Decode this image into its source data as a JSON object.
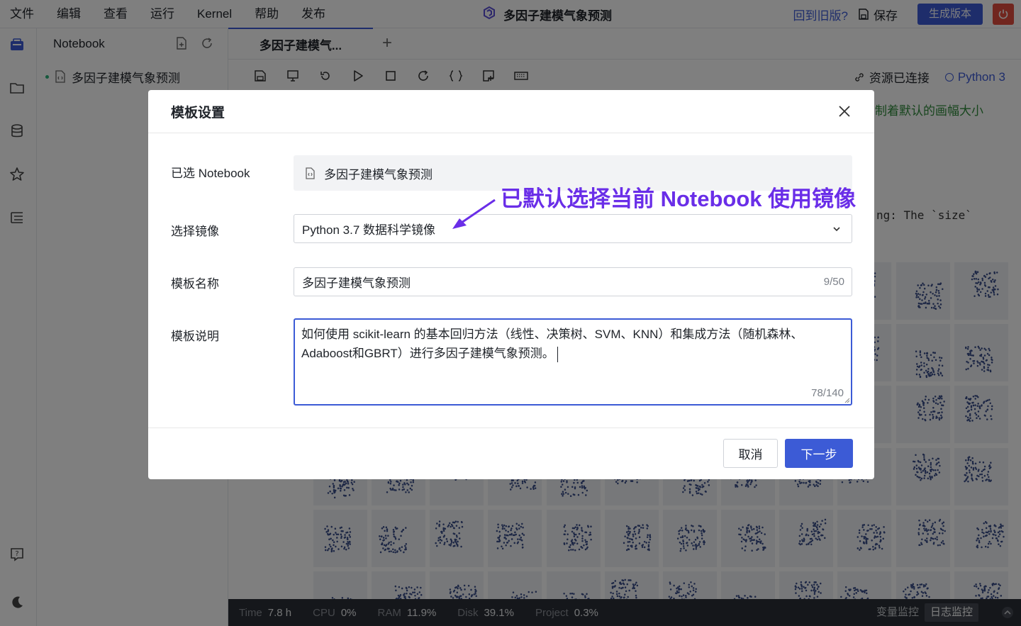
{
  "menubar": {
    "items": [
      "文件",
      "编辑",
      "查看",
      "运行",
      "Kernel",
      "帮助",
      "发布"
    ],
    "title": "多因子建模气象预测",
    "old_version": "回到旧版?",
    "save": "保存",
    "generate": "生成版本"
  },
  "filepanel": {
    "header": "Notebook",
    "file": "多因子建模气象预测"
  },
  "editor": {
    "tab": "多因子建模气...",
    "connection": "资源已连接",
    "kernel": "Python 3",
    "green_note": "制着默认的画幅大小",
    "code_note": "ng: The `size`"
  },
  "status": {
    "time_label": "Time",
    "time_value": "7.8 h",
    "cpu_label": "CPU",
    "cpu_value": "0%",
    "ram_label": "RAM",
    "ram_value": "11.9%",
    "disk_label": "Disk",
    "disk_value": "39.1%",
    "project_label": "Project",
    "project_value": "0.3%",
    "tab_var": "变量监控",
    "tab_log": "日志监控"
  },
  "modal": {
    "title": "模板设置",
    "notebook_label": "已选 Notebook",
    "notebook_value": "多因子建模气象预测",
    "image_label": "选择镜像",
    "image_value": "Python 3.7 数据科学镜像",
    "name_label": "模板名称",
    "name_value": "多因子建模气象预测",
    "name_count": "9/50",
    "desc_label": "模板说明",
    "desc_line1": "如何使用 scikit-learn 的基本回归方法（线性、决策树、SVM、KNN）和集成方法（随机森林、",
    "desc_line2": "Adaboost和GBRT）进行多因子建模气象预测。",
    "desc_count": "78/140",
    "cancel": "取消",
    "next": "下一步"
  },
  "annotation": "已默认选择当前 Notebook 使用镜像",
  "colors": {
    "accent": "#3c5bd6",
    "annotation": "#6a2ee8",
    "danger": "#e34d3e"
  }
}
